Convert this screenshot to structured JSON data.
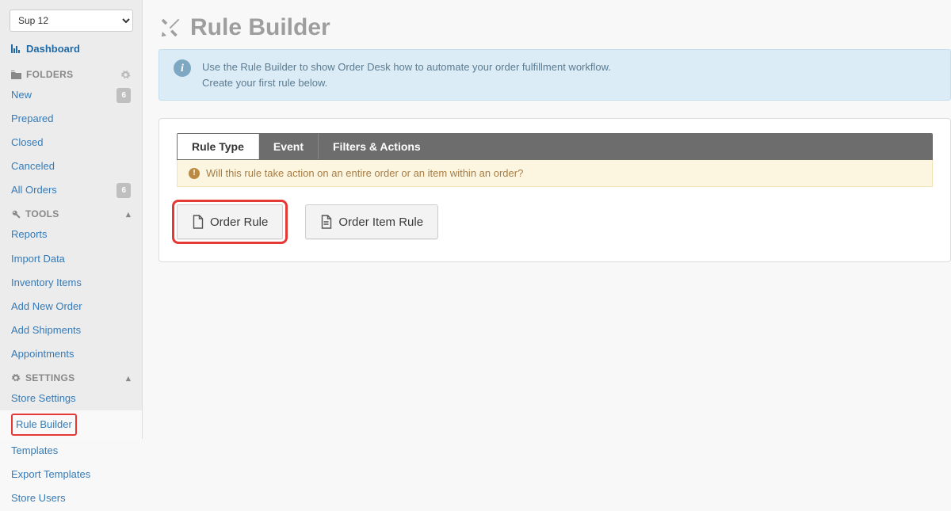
{
  "store_selector": {
    "value": "Sup 12"
  },
  "dashboard": {
    "label": "Dashboard"
  },
  "sections": {
    "folders": {
      "title": "FOLDERS",
      "items": [
        {
          "label": "New",
          "badge": "6"
        },
        {
          "label": "Prepared"
        },
        {
          "label": "Closed"
        },
        {
          "label": "Canceled"
        },
        {
          "label": "All Orders",
          "badge": "6"
        }
      ]
    },
    "tools": {
      "title": "TOOLS",
      "items": [
        {
          "label": "Reports"
        },
        {
          "label": "Import Data"
        },
        {
          "label": "Inventory Items"
        },
        {
          "label": "Add New Order"
        },
        {
          "label": "Add Shipments"
        },
        {
          "label": "Appointments"
        }
      ]
    },
    "settings": {
      "title": "SETTINGS",
      "items": [
        {
          "label": "Store Settings"
        },
        {
          "label": "Rule Builder"
        },
        {
          "label": "Templates"
        },
        {
          "label": "Export Templates"
        },
        {
          "label": "Store Users"
        }
      ]
    }
  },
  "page": {
    "title": "Rule Builder",
    "note_line1": "Use the Rule Builder to show Order Desk how to automate your order fulfillment workflow.",
    "note_line2": "Create your first rule below."
  },
  "tabs": {
    "rule_type": "Rule Type",
    "event": "Event",
    "filters_actions": "Filters & Actions"
  },
  "question": "Will this rule take action on an entire order or an item within an order?",
  "buttons": {
    "order_rule": "Order Rule",
    "order_item_rule": "Order Item Rule"
  }
}
